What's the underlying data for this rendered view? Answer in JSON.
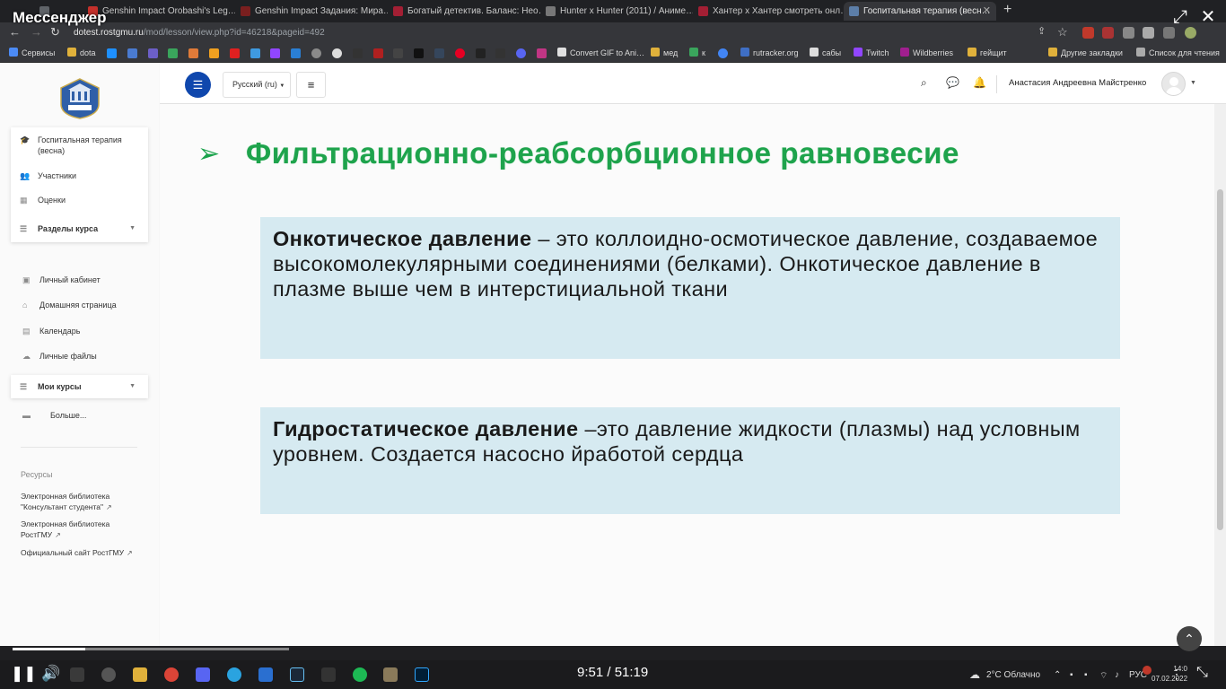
{
  "overlay": {
    "title": "Мессенджер",
    "expand_icon": "expand-icon",
    "close_icon": "close-icon"
  },
  "tabs": [
    {
      "label": "Genshin Impact Orobashi's Leg…",
      "color": "#c4302b"
    },
    {
      "label": "Genshin Impact Задания: Мира…",
      "color": "#7a1f1f"
    },
    {
      "label": "Богатый детектив. Баланс: Нео…",
      "color": "#a31f34"
    },
    {
      "label": "Hunter x Hunter (2011) / Аниме…",
      "color": "#777777"
    },
    {
      "label": "Хантер х Хантер смотреть онл…",
      "color": "#a31f34"
    },
    {
      "label": "Госпитальная терапия (весн…",
      "color": "#5c7ea8"
    }
  ],
  "addressbar": {
    "host": "dotest.rostgmu.ru",
    "path": "/mod/lesson/view.php?id=46218&pageid=492"
  },
  "bookmarks": [
    {
      "label": "Сервисы",
      "color": "#4c8bf5"
    },
    {
      "label": "dota",
      "color": "#e0b13b"
    },
    {
      "label": "Convert GIF to Ani…",
      "color": "#e0e0e0"
    },
    {
      "label": "мед",
      "color": "#e0b13b"
    },
    {
      "label": "к",
      "color": "#3aa55c"
    },
    {
      "label": "rutracker.org",
      "color": "#3f6fc5"
    },
    {
      "label": "сабы",
      "color": "#dddddd"
    },
    {
      "label": "Twitch",
      "color": "#9146ff"
    },
    {
      "label": "Wildberries",
      "color": "#a01f8f"
    },
    {
      "label": "гейщит",
      "color": "#e0b13b"
    },
    {
      "label": "Другие закладки",
      "color": "#e0b13b"
    },
    {
      "label": "Список для чтения",
      "color": "#aaaaaa"
    }
  ],
  "sidebar": {
    "course_card": [
      {
        "label": "Госпитальная терапия (весна)",
        "icon": "graduation-icon"
      },
      {
        "label": "Участники",
        "icon": "users-icon"
      },
      {
        "label": "Оценки",
        "icon": "grades-icon"
      },
      {
        "label": "Разделы курса",
        "icon": "list-icon"
      }
    ],
    "nav": [
      {
        "label": "Личный кабинет",
        "icon": "dashboard-icon"
      },
      {
        "label": "Домашняя страница",
        "icon": "home-icon"
      },
      {
        "label": "Календарь",
        "icon": "calendar-icon"
      },
      {
        "label": "Личные файлы",
        "icon": "files-icon"
      }
    ],
    "my_courses": "Мои курсы",
    "more": "Больше...",
    "resources_heading": "Ресурсы",
    "resources": [
      "Электронная библиотека \"Консультант студента\"",
      "Электронная библиотека РостГМУ",
      "Официальный сайт РостГМУ"
    ]
  },
  "topbar": {
    "language": "Русский (ru)",
    "user_name": "Анастасия Андреевна Майстренко"
  },
  "slide": {
    "title": "Фильтрационно-реабсорбционное равновесие",
    "box1_term": "Онкотическое давление",
    "box1_text": " – это коллоидно-осмотическое давление, создаваемое высокомолекулярными соединениями (белками). Онкотическое давление в плазме выше чем в интерстициальной ткани",
    "box2_term": "Гидростатическое давление",
    "box2_text": " –это давление жидкости (плазмы) над условным уровнем. Создается насосно йработой сердца"
  },
  "player": {
    "time": "9:51 / 51:19",
    "progress": 0.192
  },
  "taskbar": {
    "weather": "2°C  Облачно",
    "lang": "РУС",
    "clock_time": "14:0",
    "clock_date": "07.02.2022"
  }
}
